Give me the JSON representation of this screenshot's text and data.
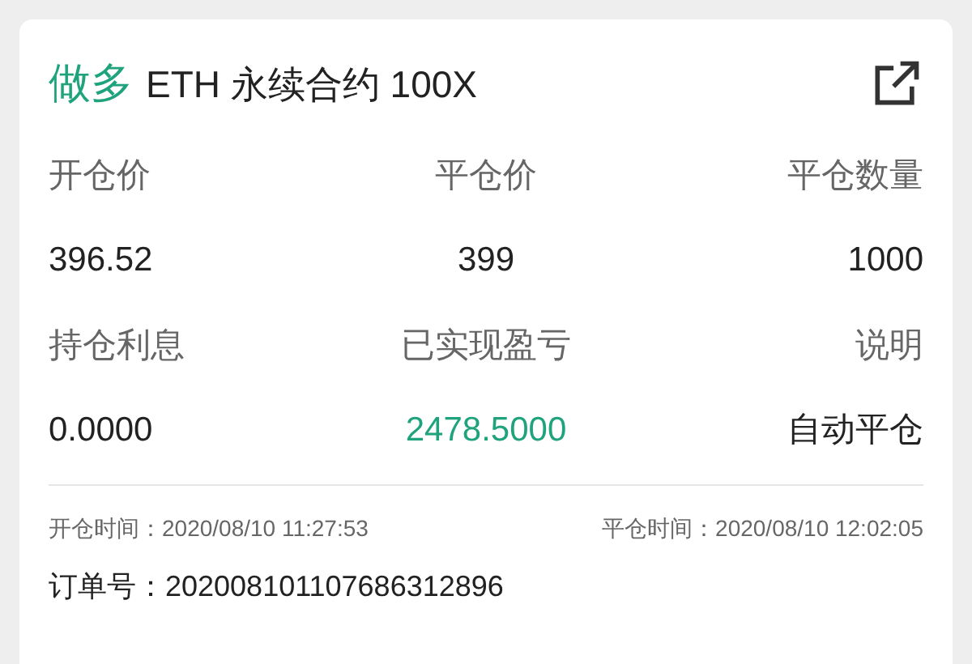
{
  "header": {
    "direction": "做多",
    "title": "ETH 永续合约 100X"
  },
  "fields": [
    {
      "label": "开仓价",
      "value": "396.52",
      "highlight": false
    },
    {
      "label": "平仓价",
      "value": "399",
      "highlight": false
    },
    {
      "label": "平仓数量",
      "value": "1000",
      "highlight": false
    },
    {
      "label": "持仓利息",
      "value": "0.0000",
      "highlight": false
    },
    {
      "label": "已实现盈亏",
      "value": "2478.5000",
      "highlight": true
    },
    {
      "label": "说明",
      "value": "自动平仓",
      "highlight": false
    }
  ],
  "footer": {
    "open_time": "开仓时间：2020/08/10 11:27:53",
    "close_time": "平仓时间：2020/08/10 12:02:05",
    "order": "订单号：202008101107686312896"
  }
}
